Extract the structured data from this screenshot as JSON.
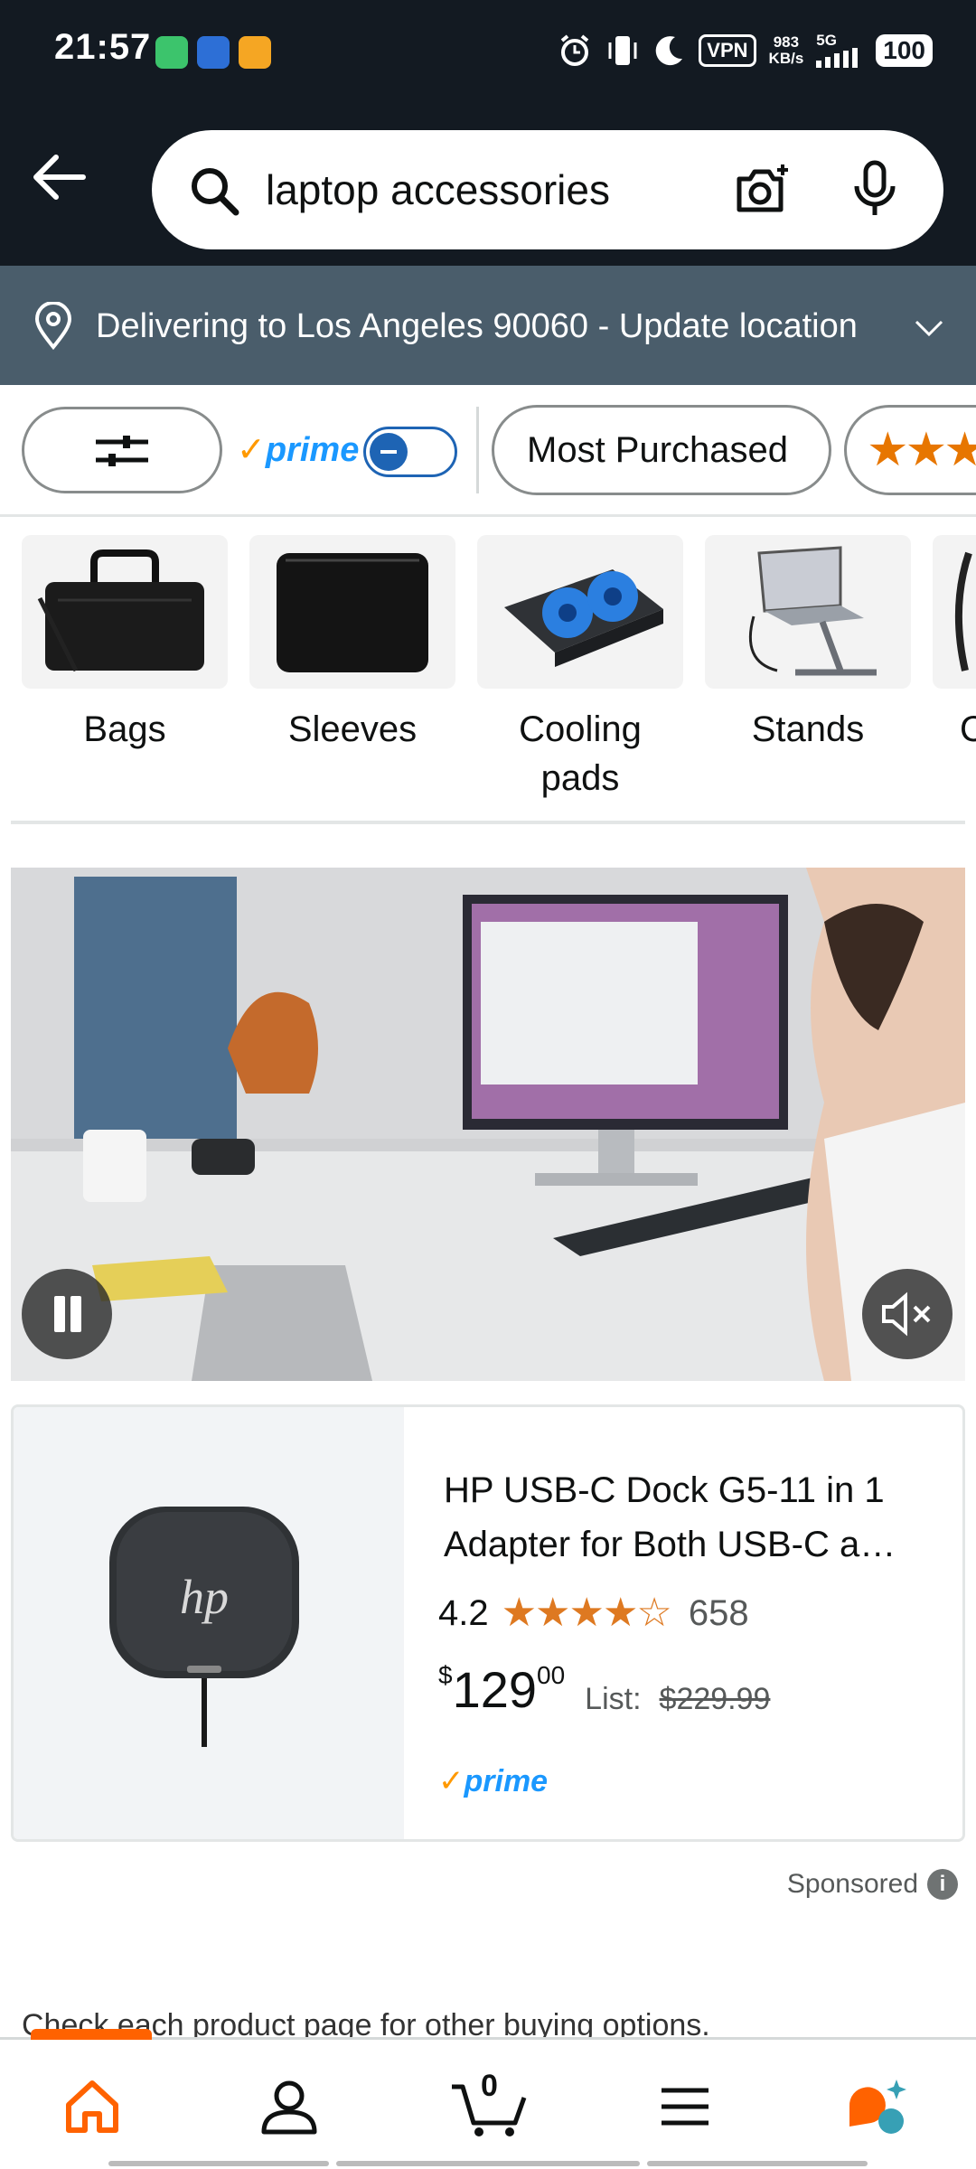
{
  "status_bar": {
    "time": "21:57",
    "vpn": "VPN",
    "speed_value": "983",
    "speed_unit": "KB/s",
    "network": "5G",
    "battery": "100"
  },
  "search": {
    "query": "laptop accessories"
  },
  "delivery": {
    "text": "Delivering to Los Angeles 90060 - Update location"
  },
  "filters": {
    "prime_label": "prime",
    "chips": [
      "Most Purchased"
    ]
  },
  "categories": [
    {
      "label": "Bags"
    },
    {
      "label": "Sleeves"
    },
    {
      "label": "Cooling pads"
    },
    {
      "label": "Stands"
    },
    {
      "label": "C"
    }
  ],
  "product": {
    "title": "HP USB-C Dock G5-11 in 1 Adapter for Both USB-C a…",
    "rating": "4.2",
    "rating_value": 4.2,
    "review_count": "658",
    "price_symbol": "$",
    "price_whole": "129",
    "price_fraction": "00",
    "list_label": "List:",
    "list_price": "$229.99",
    "prime_label": "prime"
  },
  "sponsored": {
    "label": "Sponsored"
  },
  "footer_note": "Check each product page for other buying options.",
  "nav": {
    "cart_count": "0"
  },
  "colors": {
    "header_bg": "#131a22",
    "delivery_bg": "#4a5d6b",
    "accent_orange": "#ff6200",
    "prime_blue": "#1a98ff",
    "star_orange": "#de7921"
  }
}
